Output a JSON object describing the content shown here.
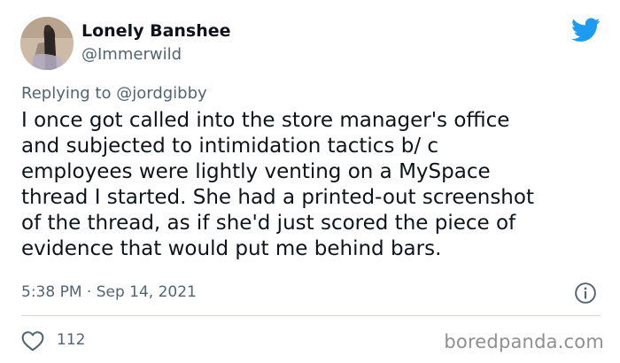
{
  "user": {
    "display_name": "Lonely Banshee",
    "handle": "@Immerwild",
    "avatar_icon": "profile-photo"
  },
  "reply": {
    "prefix": "Replying to",
    "handle": "@jordgibby"
  },
  "tweet": {
    "lines": [
      "I once got called into the store manager's office",
      "and subjected to intimidation tactics b/ c",
      "employees were lightly venting on a MySpace",
      "thread I started. She had a printed-out screenshot",
      "of the thread, as if she'd just scored the piece of",
      "evidence that would put me behind bars."
    ]
  },
  "meta": {
    "timestamp": "5:38 PM · Sep 14, 2021",
    "likes": "112"
  },
  "icons": {
    "brand": "twitter-bird-icon",
    "info": "info-icon",
    "like": "heart-icon"
  },
  "colors": {
    "brand_blue": "#1d9bf0",
    "text_primary": "#0f1419",
    "text_secondary": "#536471",
    "divider": "#cfd9de",
    "watermark": "#8f8f8f"
  },
  "watermark": "boredpanda.com"
}
